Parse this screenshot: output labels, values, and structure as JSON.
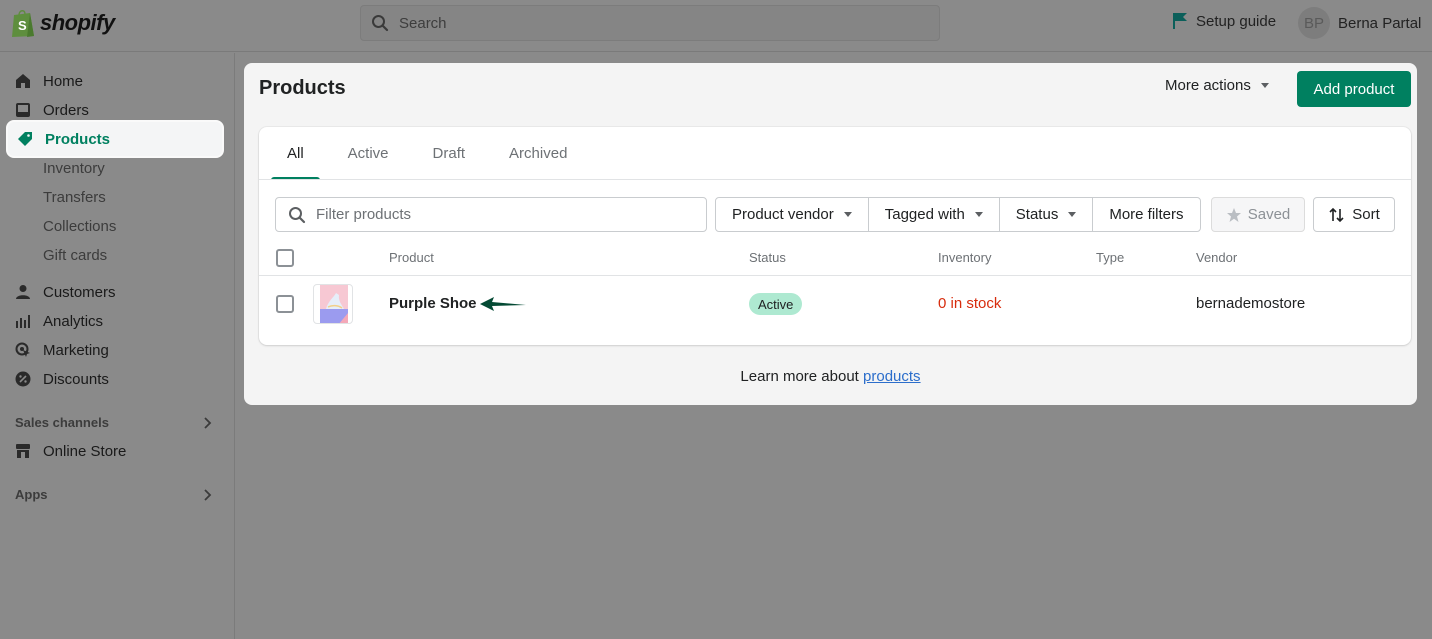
{
  "topbar": {
    "logo_text": "shopify",
    "search_placeholder": "Search",
    "setup_guide": "Setup guide",
    "user_initials": "BP",
    "user_name": "Berna Partal"
  },
  "sidebar": {
    "items": [
      {
        "label": "Home",
        "icon": "home-icon"
      },
      {
        "label": "Orders",
        "icon": "orders-icon"
      },
      {
        "label": "Products",
        "icon": "tag-icon",
        "active": true
      },
      {
        "label": "Customers",
        "icon": "person-icon"
      },
      {
        "label": "Analytics",
        "icon": "bar-chart-icon"
      },
      {
        "label": "Marketing",
        "icon": "target-icon"
      },
      {
        "label": "Discounts",
        "icon": "discount-icon"
      }
    ],
    "product_subitems": [
      "Inventory",
      "Transfers",
      "Collections",
      "Gift cards"
    ],
    "sales_channels_label": "Sales channels",
    "online_store": "Online Store",
    "apps_label": "Apps"
  },
  "main": {
    "title": "Products",
    "more_actions": "More actions",
    "add_product": "Add product",
    "tabs": [
      "All",
      "Active",
      "Draft",
      "Archived"
    ],
    "active_tab": "All",
    "filter_placeholder": "Filter products",
    "filters": [
      "Product vendor",
      "Tagged with",
      "Status",
      "More filters"
    ],
    "saved": "Saved",
    "sort": "Sort",
    "columns": [
      "Product",
      "Status",
      "Inventory",
      "Type",
      "Vendor"
    ],
    "rows": [
      {
        "product": "Purple Shoe",
        "status": "Active",
        "inventory": "0 in stock",
        "type": "",
        "vendor": "bernademostore"
      }
    ],
    "learn_more_prefix": "Learn more about",
    "learn_more_link": "products"
  },
  "colors": {
    "brand": "#008060",
    "badge_active": "#aee9d1",
    "out_of_stock": "#d72c0d",
    "link": "#2c6ecb"
  }
}
